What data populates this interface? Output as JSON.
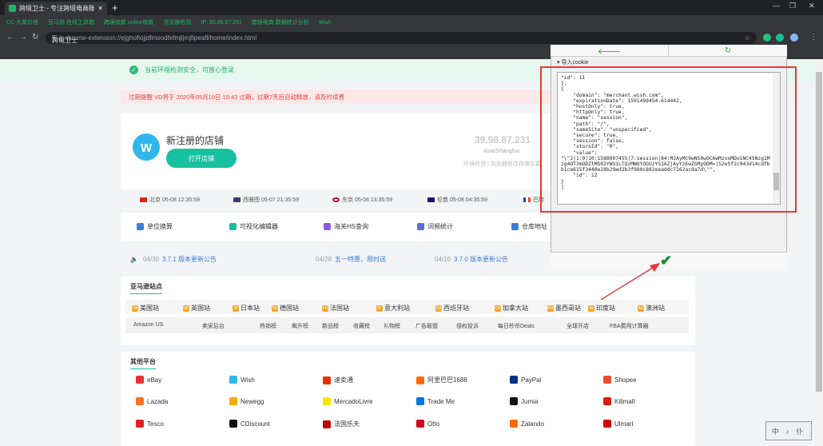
{
  "browser": {
    "tab_title": "跨境卫士 - 专注跨境电商账号安全",
    "new_tab": "+",
    "window_controls": [
      "—",
      "❐",
      "✕"
    ],
    "bookmarks": [
      "CC 大单价格",
      "亚马逊 在线工具箱",
      "跨境收款 online收款",
      "浏览器检测",
      "IP: 95.86.87.231",
      "跨境电商 数据统计分析",
      "Wish"
    ],
    "address_site": "跨境卫士",
    "address_url": "chrome-extension://ejghofiojjdfmoodfefmjljmjfipeafl/home/index.html"
  },
  "page": {
    "safe_message": "当前环境检测安全，可放心登录",
    "notice": "过期提醒 VD将于 2020年05月10日 15:43 过期，过期7天后自动释放，请及时续费",
    "store": {
      "logo": "w",
      "name": "新注册的店铺",
      "open_button": "打开店铺",
      "ip": "39.98.87.231",
      "location": "Asia/Shanghai",
      "ip_note": "环境检测 | 浏览器修改存储位置"
    },
    "clocks": [
      {
        "flag": "#de2910",
        "text": "北京 05-08 12:35:59"
      },
      {
        "flag": "#3c3b6e",
        "text": "西雅图 05-07 21:35:59"
      },
      {
        "flag": "#bc002d",
        "text": "东京 05-08 13:35:59"
      },
      {
        "flag": "#012169",
        "text": "伦敦 05-08 04:35:59"
      },
      {
        "flag": "#0055a4",
        "text": "巴黎"
      }
    ],
    "tools": [
      {
        "icon": "#3a7bd5",
        "label": "单位换算"
      },
      {
        "icon": "#17c0a0",
        "label": "可视化编辑器"
      },
      {
        "icon": "#8e5ad8",
        "label": "海关HS查询"
      },
      {
        "icon": "#5b6bd8",
        "label": "词频统计"
      },
      {
        "icon": "#3a7bd5",
        "label": "仓库地址"
      }
    ],
    "updates": [
      {
        "date": "04/30",
        "text": "3.7.1 版本更新公告"
      },
      {
        "date": "04/28",
        "text": "五一特惠，限时送"
      },
      {
        "date": "04/10",
        "text": "3.7.0 版本更新公告"
      }
    ],
    "amazon": {
      "title": "亚马逊站点",
      "sites": [
        "美国站",
        "英国站",
        "日本站",
        "德国站",
        "法国站",
        "意大利站",
        "西班牙站",
        "加拿大站",
        "墨西哥站",
        "印度站",
        "澳洲站"
      ],
      "site_badges": [
        "US",
        "UK",
        "JP",
        "DE",
        "FR",
        "IT",
        "ES",
        "CA",
        "MX",
        "IN",
        "AU"
      ],
      "links": [
        "Amazon US",
        "卖家后台",
        "热销榜",
        "飙升榜",
        "新品榜",
        "收藏榜",
        "礼物榜",
        "广告联盟",
        "侵权投诉",
        "每日秒杀Deals",
        "全球开店",
        "FBA费用计算器"
      ]
    },
    "other": {
      "title": "其他平台",
      "platforms": [
        {
          "name": "eBay",
          "color": "#e53238"
        },
        {
          "name": "Wish",
          "color": "#2fb7ec"
        },
        {
          "name": "速卖通",
          "color": "#e62e04"
        },
        {
          "name": "阿里巴巴1688",
          "color": "#ff6a00"
        },
        {
          "name": "PayPal",
          "color": "#003087"
        },
        {
          "name": "Shopee",
          "color": "#ee4d2d"
        },
        {
          "name": "Lazada",
          "color": "#f57224"
        },
        {
          "name": "Newegg",
          "color": "#f7a800"
        },
        {
          "name": "MercadoLivre",
          "color": "#ffe600"
        },
        {
          "name": "Trade Me",
          "color": "#0073e6"
        },
        {
          "name": "Jumia",
          "color": "#111111"
        },
        {
          "name": "Kilimall",
          "color": "#d81e06"
        },
        {
          "name": "Tesco",
          "color": "#e0201f"
        },
        {
          "name": "CDiscount",
          "color": "#111111"
        },
        {
          "name": "法国乐天",
          "color": "#bf0000"
        },
        {
          "name": "Otto",
          "color": "#d4021d"
        },
        {
          "name": "Zalando",
          "color": "#ff6900"
        },
        {
          "name": "Ulmart",
          "color": "#d40000"
        }
      ]
    }
  },
  "popup": {
    "back_icon": "🡐",
    "refresh_icon": "↻",
    "section_label": "▾ 导入cookie",
    "cookie_text": "\"id\": 11\n},\n{\n    \"domain\": \"merchant.wish.com\",\n    \"expirationDate\": 1591499454.614442,\n    \"hostOnly\": true,\n    \"httpOnly\": true,\n    \"name\": \"session\",\n    \"path\": \"/\",\n    \"sameSite\": \"unspecified\",\n    \"secure\": true,\n    \"session\": false,\n    \"storeId\": \"0\",\n    \"value\":\n\"\\\"2|1:0|10:1588907455|7:session|84:MJAyMC0wNS0wOCAwMzoxMDo1NC45Nzg1Mzg4OTJmODZlMS02YWU1LTQzMWQtOGUzYS1kZjAyYzEwZGMyODM=|52e5f2c943d14cdfbb1ce615f3440e28b29ed2b3f980c882eeaddc7162acda7d\\\"\",\n    \"id\": 12\n}\n]",
    "ok_icon": "✔"
  },
  "watermark": "中 ♪ 仆",
  "colors": {
    "accent": "#17c0a0",
    "highlight": "#e53935",
    "ok": "#1c8a2e"
  }
}
